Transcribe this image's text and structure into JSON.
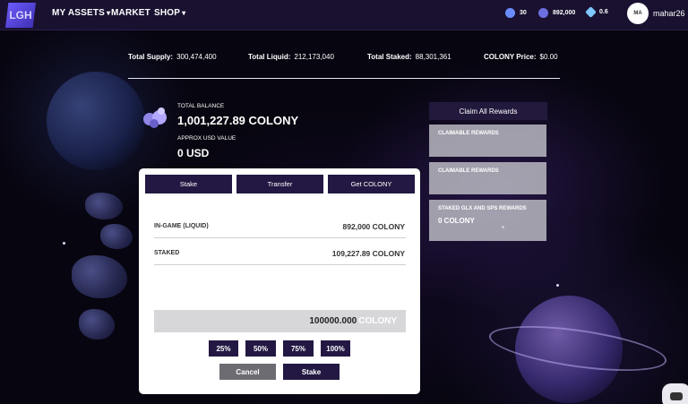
{
  "nav": {
    "logo": "LGH",
    "items": [
      "MY ASSETS",
      "MARKET",
      "SHOP"
    ],
    "stats": [
      {
        "icon": "plus-circle-icon",
        "value": "30",
        "color": "#6a8cff"
      },
      {
        "icon": "token-icon",
        "value": "892,000",
        "color": "#6b6fe0"
      },
      {
        "icon": "rocket-icon",
        "value": "0.6",
        "color": "#7ec8ff"
      }
    ],
    "avatar": "MA",
    "username": "mahar26"
  },
  "stats": {
    "supply_label": "Total Supply:",
    "supply_value": "300,474,400",
    "liquid_label": "Total Liquid:",
    "liquid_value": "212,173,040",
    "staked_label": "Total Staked:",
    "staked_value": "88,301,361",
    "price_label": "COLONY Price:",
    "price_value": "$0.00"
  },
  "balance": {
    "total_label": "TOTAL BALANCE",
    "total_value": "1,001,227.89 COLONY",
    "usd_label": "APPROX USD VALUE",
    "usd_value": "0 USD"
  },
  "rewards": {
    "claim_all": "Claim All Rewards",
    "cards": [
      {
        "label": "CLAIMABLE REWARDS",
        "value": ""
      },
      {
        "label": "CLAIMABLE REWARDS",
        "value": ""
      },
      {
        "label": "STAKED GLX AND SPS REWARDS",
        "value": "0 COLONY"
      }
    ]
  },
  "modal": {
    "tabs": [
      "Stake",
      "Transfer",
      "Get COLONY"
    ],
    "ingame_label": "IN-GAME (LIQUID)",
    "ingame_value": "892,000 COLONY",
    "staked_label": "STAKED",
    "staked_value": "109,227.89 COLONY",
    "amount_value": "100000.000",
    "amount_unit": "COLONY",
    "percent_buttons": [
      "25%",
      "50%",
      "75%",
      "100%"
    ],
    "cancel": "Cancel",
    "stake": "Stake"
  }
}
